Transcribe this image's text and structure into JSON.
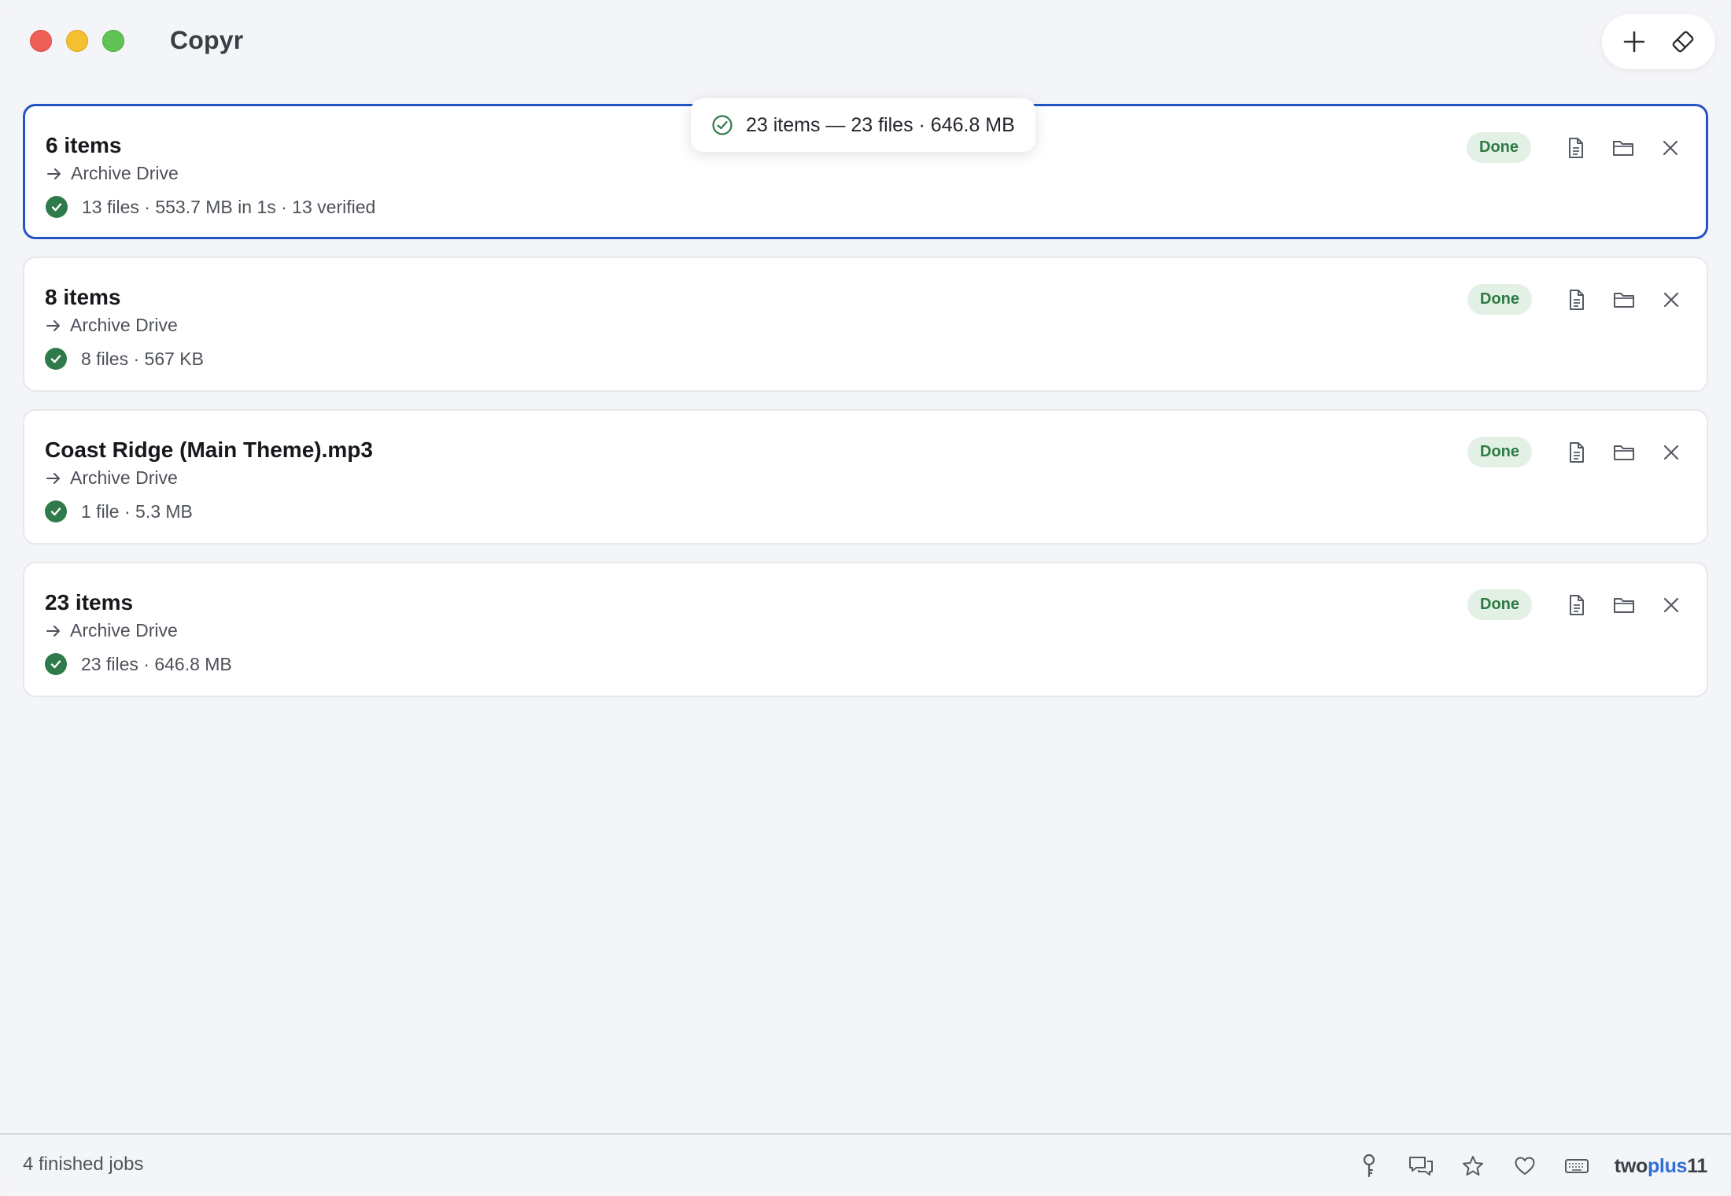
{
  "window": {
    "title": "Copyr"
  },
  "toast": {
    "text": "23 items — 23 files · 646.8 MB"
  },
  "jobs": [
    {
      "title": "6 items",
      "destination": "Archive Drive",
      "stats": "13 files · 553.7 MB in 1s · 13 verified",
      "status": "Done",
      "selected": true
    },
    {
      "title": "8 items",
      "destination": "Archive Drive",
      "stats": "8 files · 567 KB",
      "status": "Done",
      "selected": false
    },
    {
      "title": "Coast Ridge (Main Theme).mp3",
      "destination": "Archive Drive",
      "stats": "1 file · 5.3 MB",
      "status": "Done",
      "selected": false
    },
    {
      "title": "23 items",
      "destination": "Archive Drive",
      "stats": "23 files · 646.8 MB",
      "status": "Done",
      "selected": false
    }
  ],
  "footer": {
    "status": "4 finished jobs",
    "brand": {
      "part1": "two",
      "part2": "plus",
      "part3": "11"
    }
  },
  "colors": {
    "accent": "#2354c3",
    "success": "#2f7a4a",
    "badge_bg": "#e3f0e5"
  },
  "icons": {
    "title_actions": [
      "plus-icon",
      "eraser-icon"
    ],
    "job_actions": [
      "document-icon",
      "folder-icon",
      "close-icon"
    ],
    "footer": [
      "key-icon",
      "chat-icon",
      "star-icon",
      "heart-icon",
      "keyboard-icon"
    ]
  }
}
